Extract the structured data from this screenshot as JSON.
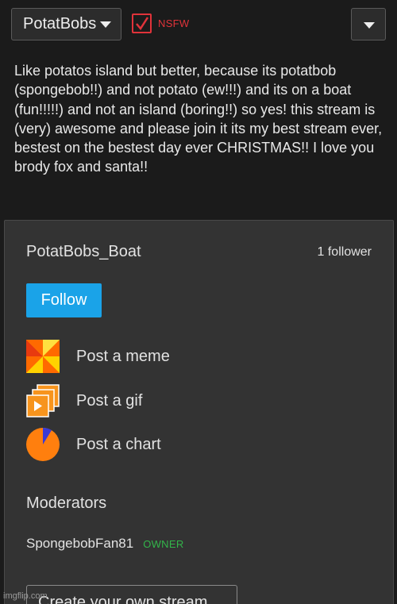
{
  "header": {
    "stream_name": "PotatBobs",
    "nsfw_label": "NSFW",
    "nsfw_checked": true
  },
  "description": "Like potatos island but better, because its potatbob (spongebob!!) and not potato (ew!!!) and its on a boat (fun!!!!!) and not an island (boring!!) so yes! this stream is (very) awesome and please join it its my best stream ever, bestest on the bestest day ever CHRISTMAS!! I love you brody fox and santa!!",
  "panel": {
    "title": "PotatBobs_Boat",
    "followers": "1 follower",
    "follow_label": "Follow",
    "actions": [
      {
        "label": "Post a meme",
        "icon": "meme-icon"
      },
      {
        "label": "Post a gif",
        "icon": "gif-icon"
      },
      {
        "label": "Post a chart",
        "icon": "chart-icon"
      }
    ],
    "moderators_title": "Moderators",
    "moderators": [
      {
        "name": "SpongebobFan81",
        "role": "OWNER"
      }
    ],
    "create_label": "Create your own stream"
  },
  "watermark": "imgflip.com",
  "colors": {
    "accent": "#1aa3e8",
    "nsfw": "#e0333a",
    "owner": "#33b54a",
    "background": "#1b1b1b",
    "panel": "#333333"
  }
}
